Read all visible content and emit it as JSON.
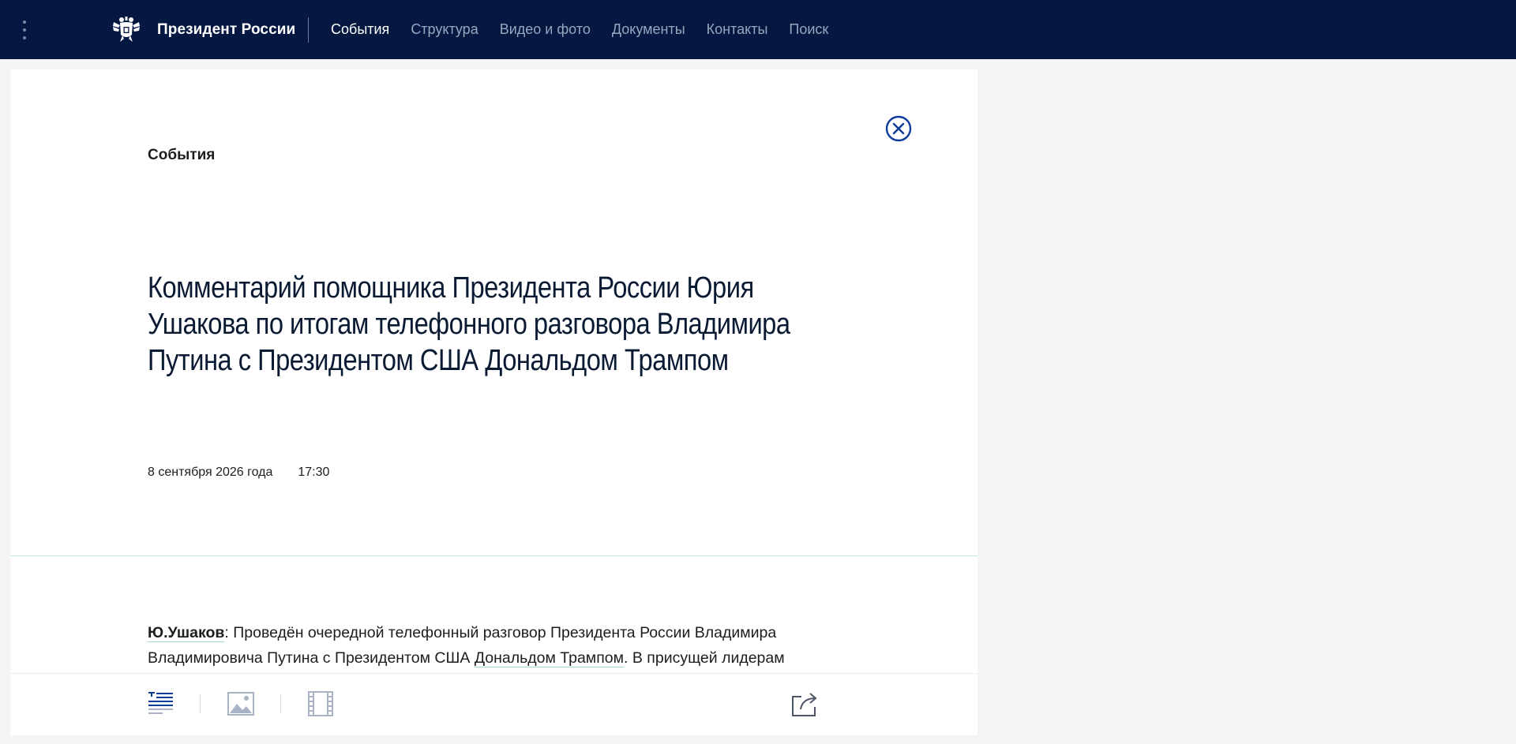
{
  "header": {
    "site_title": "Президент России",
    "nav": [
      {
        "label": "События",
        "active": true
      },
      {
        "label": "Структура",
        "active": false
      },
      {
        "label": "Видео и фото",
        "active": false
      },
      {
        "label": "Документы",
        "active": false
      },
      {
        "label": "Контакты",
        "active": false
      },
      {
        "label": "Поиск",
        "active": false
      }
    ]
  },
  "article": {
    "section": "События",
    "title": "Комментарий помощника Президента России Юрия Ушакова по итогам телефонного разговора Владимира Путина с Президентом США Дональдом Трампом",
    "date": "8 сентября 2026 года",
    "time": "17:30",
    "body": {
      "speaker": "Ю.Ушаков",
      "text_1": ": Проведён очередной телефонный разговор Президента России Владимира Владимировича Путина с Президентом США ",
      "link": "Дональдом Трампом",
      "text_2": ". В присущей лидерам"
    }
  },
  "icons": {
    "menu": "menu-dots-icon",
    "logo": "coat-of-arms-icon",
    "close": "close-circle-icon",
    "text_view": "text-view-icon",
    "photo_view": "photo-icon",
    "video_view": "video-icon",
    "share": "share-icon"
  },
  "colors": {
    "header_bg": "#041841",
    "accent_blue": "#0d3b9c",
    "link_underline": "#9fd6cc",
    "divider": "#bfe8e0"
  }
}
